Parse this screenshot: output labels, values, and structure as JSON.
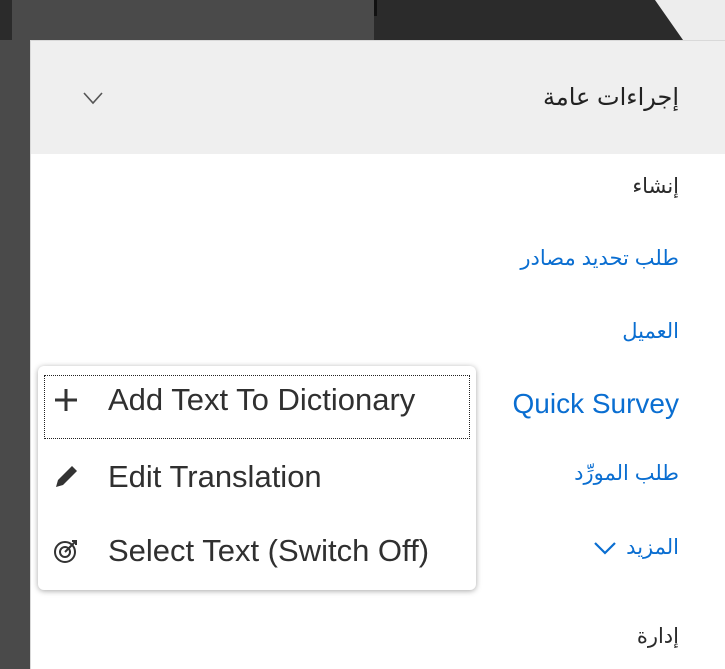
{
  "header": {
    "title": "إجراءات عامة"
  },
  "actions": [
    {
      "label": "إنشاء",
      "type": "plain"
    },
    {
      "label": "طلب تحديد مصادر",
      "type": "link"
    },
    {
      "label": "العميل",
      "type": "link"
    },
    {
      "label": "Quick Survey",
      "type": "link"
    },
    {
      "label": "طلب المورِّد",
      "type": "link"
    },
    {
      "label": "المزيد",
      "type": "link"
    },
    {
      "label": "إدارة",
      "type": "plain"
    }
  ],
  "context_menu": {
    "items": [
      {
        "label": "Add Text To Dictionary",
        "icon": "plus-icon"
      },
      {
        "label": "Edit Translation",
        "icon": "pencil-icon"
      },
      {
        "label": "Select Text (Switch Off)",
        "icon": "target-icon"
      }
    ]
  },
  "colors": {
    "link": "#0a6ed1",
    "header_bg": "#efefef"
  }
}
